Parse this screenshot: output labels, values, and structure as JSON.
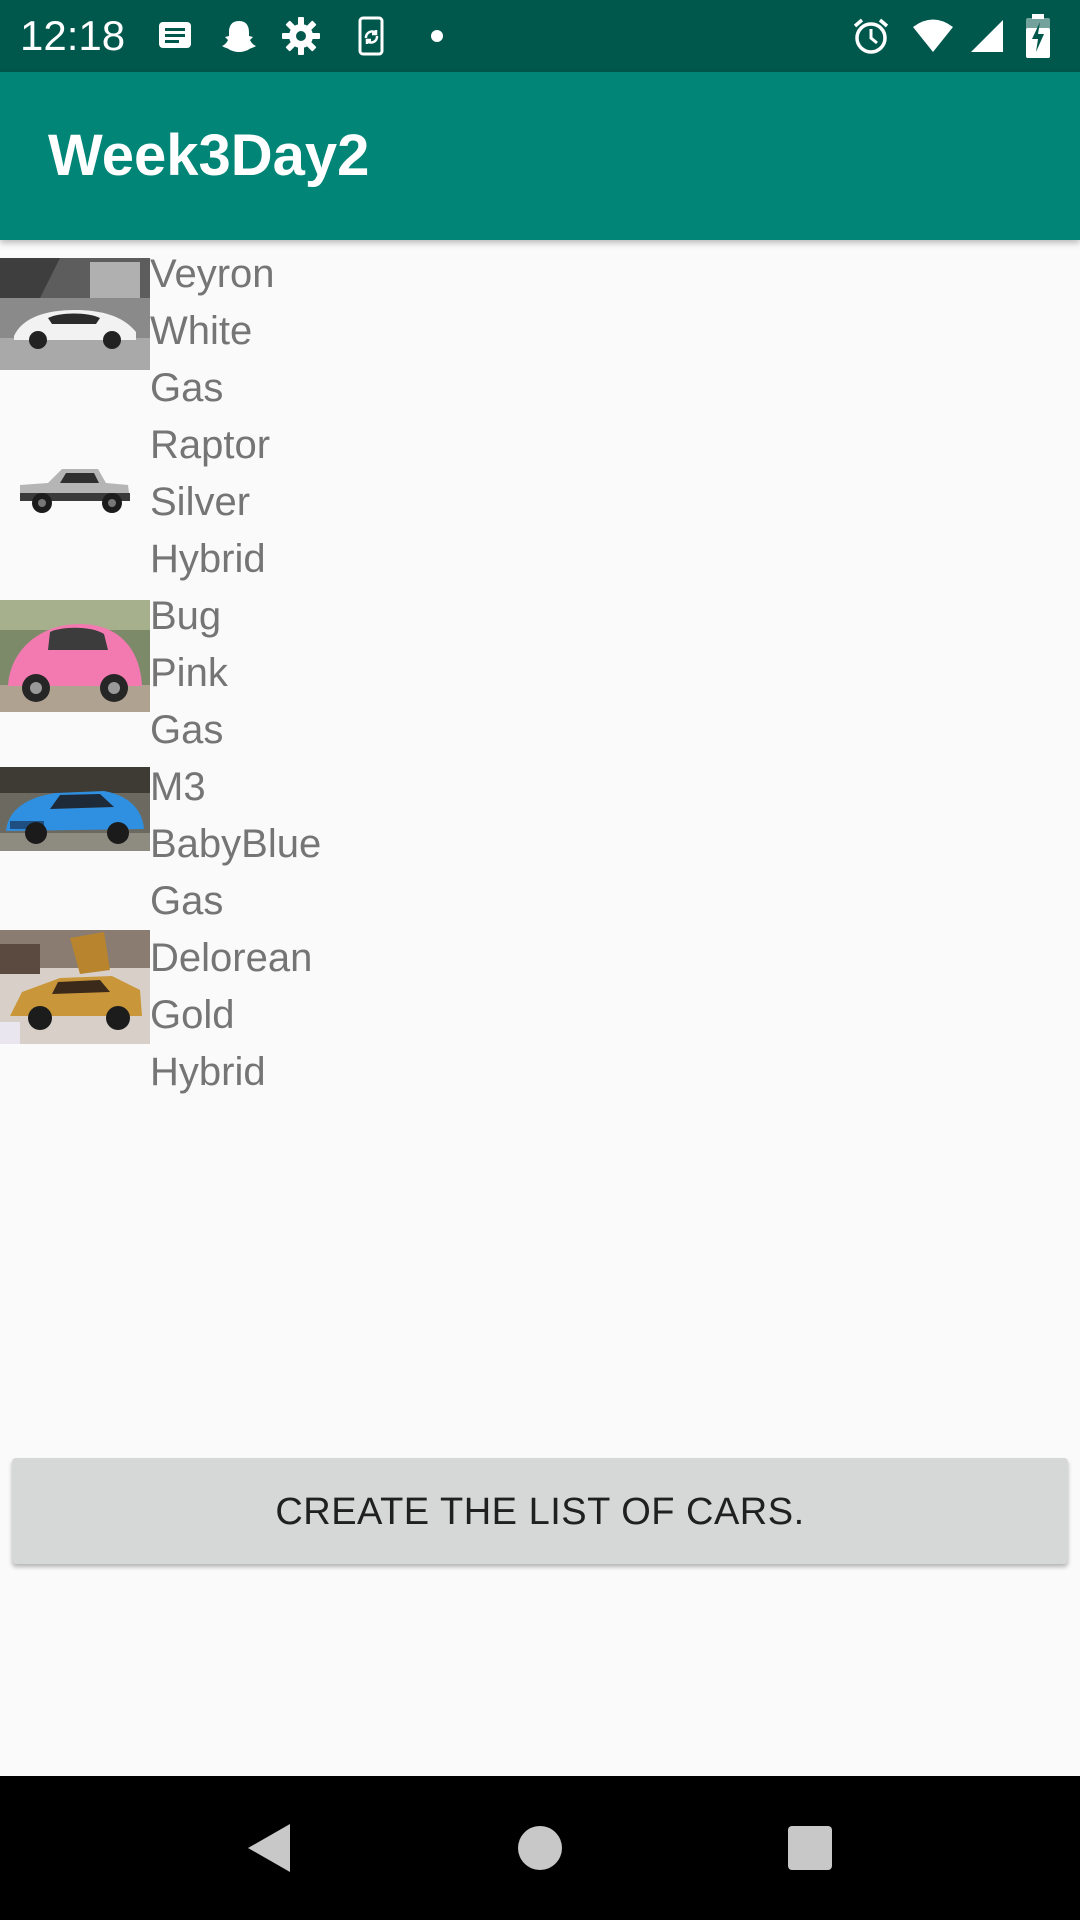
{
  "status_bar": {
    "time": "12:18",
    "left_icons": [
      "message-icon",
      "snapchat-icon",
      "settings-icon",
      "phone-sync-icon",
      "dot-icon"
    ],
    "right_icons": [
      "alarm-icon",
      "wifi-icon",
      "signal-icon",
      "battery-charging-icon"
    ],
    "background": "#00574b"
  },
  "app_bar": {
    "title": "Week3Day2",
    "background": "#008577"
  },
  "cars": [
    {
      "model": "Veyron",
      "color": "White",
      "fuel": "Gas",
      "image": "white-supercar"
    },
    {
      "model": "Raptor",
      "color": "Silver",
      "fuel": "Hybrid",
      "image": "silver-pickup-truck"
    },
    {
      "model": "Bug",
      "color": "Pink",
      "fuel": "Gas",
      "image": "pink-beetle"
    },
    {
      "model": "M3",
      "color": "BabyBlue",
      "fuel": "Gas",
      "image": "blue-sedan"
    },
    {
      "model": "Delorean",
      "color": "Gold",
      "fuel": "Hybrid",
      "image": "gold-delorean"
    }
  ],
  "button": {
    "label": "CREATE THE LIST OF CARS."
  },
  "nav_bar": {
    "buttons": [
      "back-icon",
      "home-icon",
      "recents-icon"
    ]
  }
}
